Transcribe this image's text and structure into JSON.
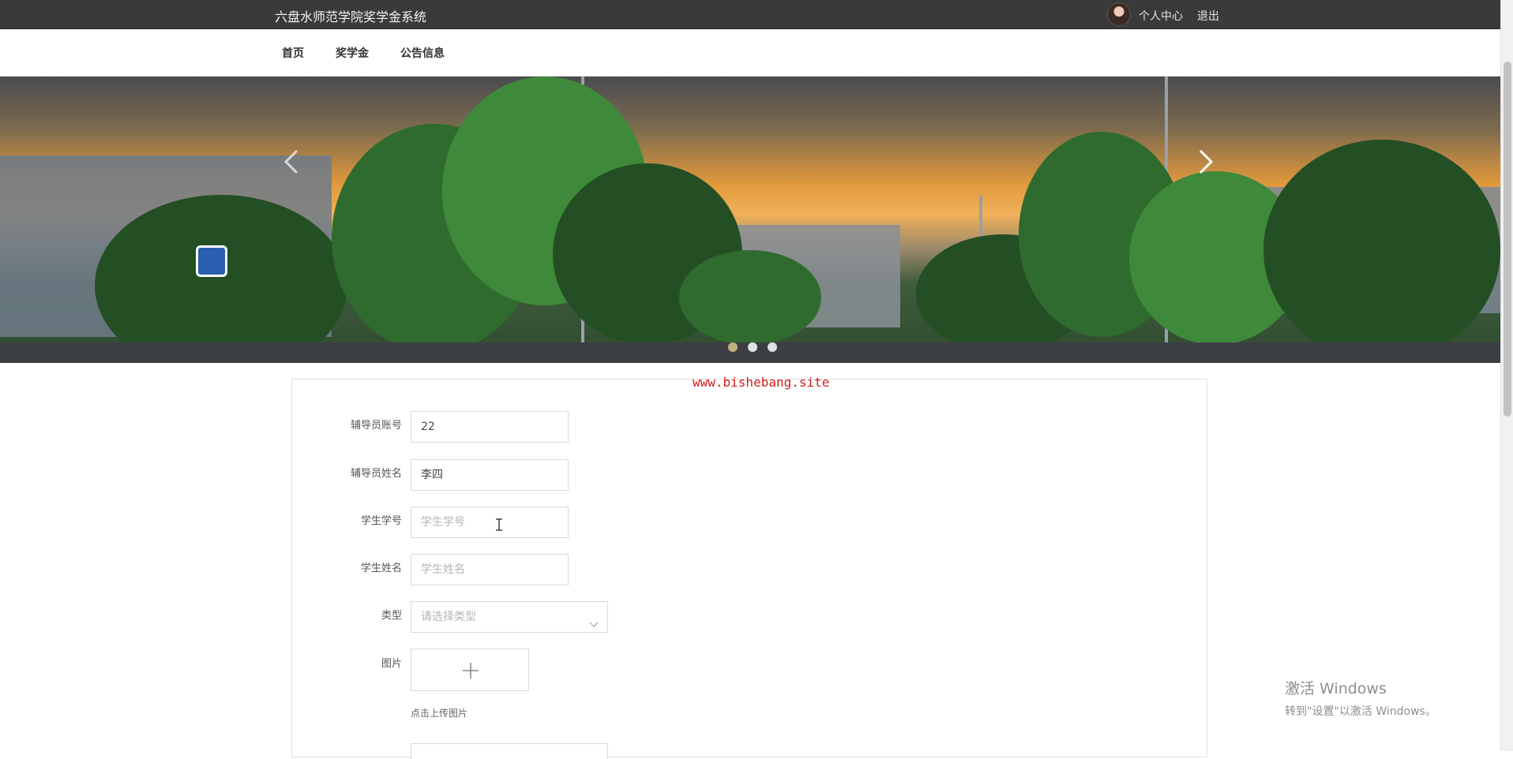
{
  "topbar": {
    "title": "六盘水师范学院奖学金系统",
    "user_center": "个人中心",
    "logout": "退出"
  },
  "nav": {
    "items": [
      {
        "label": "首页"
      },
      {
        "label": "奖学金"
      },
      {
        "label": "公告信息"
      }
    ]
  },
  "banner": {
    "slide_count": 3,
    "active_slide": 1
  },
  "watermark": "www.bishebang.site",
  "form": {
    "fields": [
      {
        "label": "辅导员账号",
        "value": "22",
        "placeholder": ""
      },
      {
        "label": "辅导员姓名",
        "value": "李四",
        "placeholder": ""
      },
      {
        "label": "学生学号",
        "value": "",
        "placeholder": "学生学号"
      },
      {
        "label": "学生姓名",
        "value": "",
        "placeholder": "学生姓名"
      }
    ],
    "type": {
      "label": "类型",
      "placeholder": "请选择类型"
    },
    "image": {
      "label": "图片",
      "hint": "点击上传图片"
    }
  },
  "windows": {
    "line1": "激活 Windows",
    "line2": "转到\"设置\"以激活 Windows。"
  }
}
